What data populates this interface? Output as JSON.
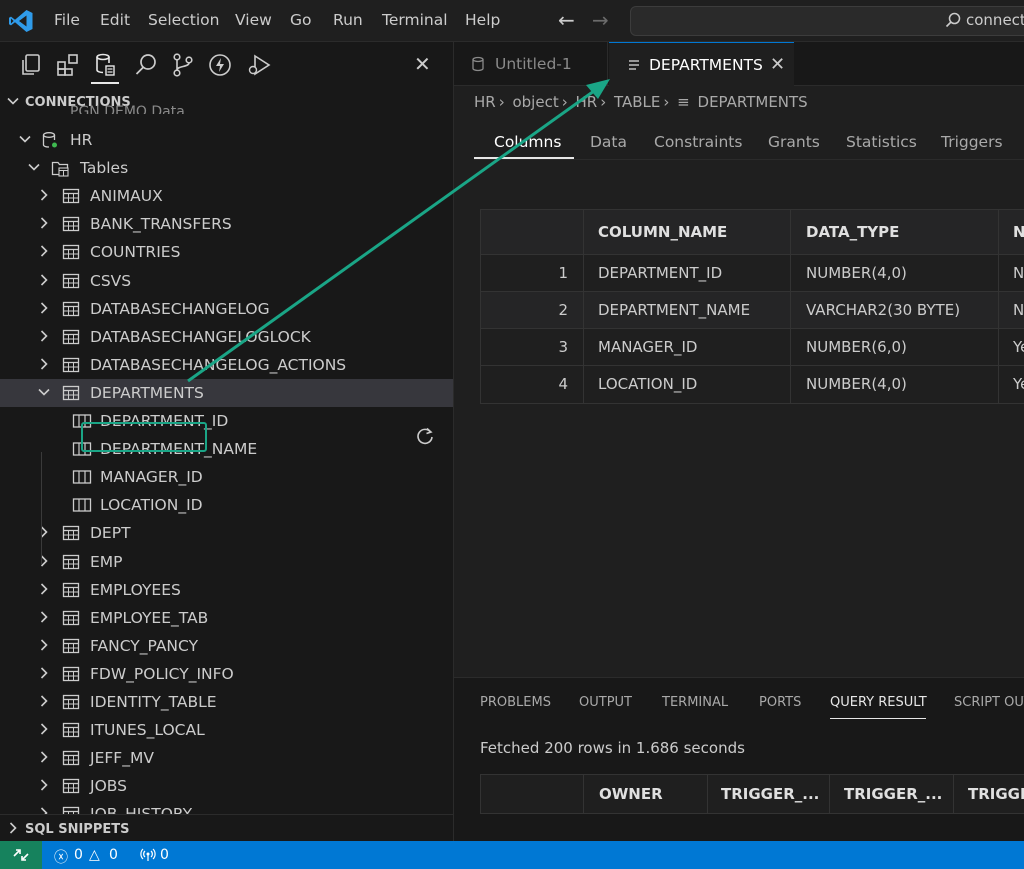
{
  "menu": [
    "File",
    "Edit",
    "Selection",
    "View",
    "Go",
    "Run",
    "Terminal",
    "Help"
  ],
  "command_center": {
    "text": "connecti"
  },
  "sidebar": {
    "section_title": "CONNECTIONS",
    "clipped_item": "PGN DEMO Data",
    "connection": "HR",
    "tables_folder": "Tables",
    "tables_before": [
      "ANIMAUX",
      "BANK_TRANSFERS",
      "COUNTRIES",
      "CSVS",
      "DATABASECHANGELOG",
      "DATABASECHANGELOGLOCK",
      "DATABASECHANGELOG_ACTIONS"
    ],
    "selected_table": "DEPARTMENTS",
    "selected_columns": [
      "DEPARTMENT_ID",
      "DEPARTMENT_NAME",
      "MANAGER_ID",
      "LOCATION_ID"
    ],
    "tables_after": [
      "DEPT",
      "EMP",
      "EMPLOYEES",
      "EMPLOYEE_TAB",
      "FANCY_PANCY",
      "FDW_POLICY_INFO",
      "IDENTITY_TABLE",
      "ITUNES_LOCAL",
      "JEFF_MV",
      "JOBS"
    ],
    "clipped_last": "JOB_HISTORY",
    "snippets_title": "SQL SNIPPETS"
  },
  "tabs": [
    {
      "label": "Untitled-1",
      "icon": "database-icon"
    },
    {
      "label": "DEPARTMENTS",
      "icon": "table-icon"
    }
  ],
  "breadcrumb": [
    "HR",
    "object",
    "HR",
    "TABLE",
    "DEPARTMENTS"
  ],
  "sub_tabs": [
    "Columns",
    "Data",
    "Constraints",
    "Grants",
    "Statistics",
    "Triggers"
  ],
  "columns_table": {
    "headers": [
      "",
      "COLUMN_NAME",
      "DATA_TYPE",
      "N"
    ],
    "rows": [
      [
        "1",
        "DEPARTMENT_ID",
        "NUMBER(4,0)",
        "N"
      ],
      [
        "2",
        "DEPARTMENT_NAME",
        "VARCHAR2(30 BYTE)",
        "N"
      ],
      [
        "3",
        "MANAGER_ID",
        "NUMBER(6,0)",
        "Ye"
      ],
      [
        "4",
        "LOCATION_ID",
        "NUMBER(4,0)",
        "Ye"
      ]
    ]
  },
  "panel": {
    "tabs": [
      "PROBLEMS",
      "OUTPUT",
      "TERMINAL",
      "PORTS",
      "QUERY RESULT",
      "SCRIPT OUT"
    ],
    "active_tab": "QUERY RESULT",
    "status": "Fetched 200 rows in 1.686 seconds",
    "result_headers": [
      "",
      "OWNER",
      "TRIGGER_...",
      "TRIGGER_...",
      "TRIGGE"
    ]
  },
  "statusbar": {
    "errors": "0",
    "warnings": "0",
    "ports": "0"
  },
  "colors": {
    "accent": "#0078d4",
    "highlight": "#1aa586",
    "remote": "#16825d"
  }
}
